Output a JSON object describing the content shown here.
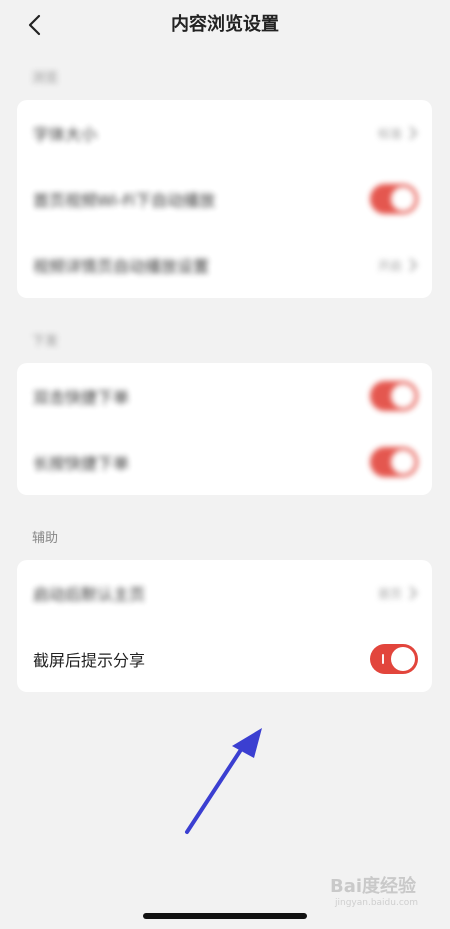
{
  "header": {
    "title": "内容浏览设置",
    "back_icon": "chevron-left-icon"
  },
  "sections": [
    {
      "label": "浏览",
      "rows": [
        {
          "label": "字体大小",
          "type": "nav",
          "value": "标准"
        },
        {
          "label": "首页视频Wi-Fi下自动播放",
          "type": "toggle",
          "on": true
        },
        {
          "label": "视频详情页自动播放设置",
          "type": "nav",
          "value": "开启"
        }
      ]
    },
    {
      "label": "下发",
      "rows": [
        {
          "label": "双击快捷下单",
          "type": "toggle",
          "on": true
        },
        {
          "label": "长按快捷下单",
          "type": "toggle",
          "on": true
        }
      ]
    },
    {
      "label": "辅助",
      "rows": [
        {
          "label": "启动后默认主页",
          "type": "nav",
          "value": "首页"
        },
        {
          "label": "截屏后提示分享",
          "type": "toggle",
          "on": true
        }
      ]
    }
  ],
  "watermark": {
    "main": "Bai度经验",
    "sub": "jingyan.baidu.com"
  },
  "colors": {
    "accent": "#e2453c",
    "arrow": "#3b3fd1",
    "background": "#f2f2f2"
  }
}
